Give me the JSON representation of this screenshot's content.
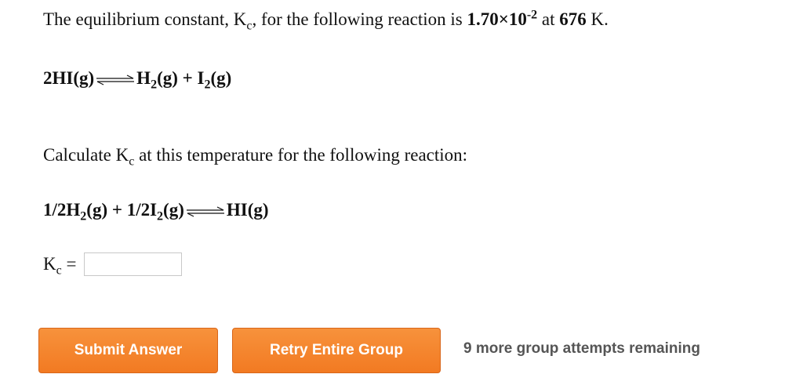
{
  "problem": {
    "intro": {
      "p1": "The equilibrium constant, K",
      "p1_sub": "c",
      "p2": ", for the following reaction is ",
      "value_mantissa": "1.70×10",
      "value_exp": "-2",
      "p3": " at ",
      "temperature": "676",
      "p4": " K."
    },
    "reaction1": {
      "reactant": "2HI(g)",
      "prod1_a": "H",
      "prod1_sub": "2",
      "prod1_b": "(g) + I",
      "prod2_sub": "2",
      "prod2_b": "(g)"
    },
    "question": {
      "p1": "Calculate K",
      "p1_sub": "c",
      "p2": " at this temperature for the following reaction:"
    },
    "reaction2": {
      "r1_a": "1/2H",
      "r1_sub": "2",
      "r1_b": "(g) + 1/2I",
      "r2_sub": "2",
      "r2_b": "(g)",
      "product": "HI(g)"
    },
    "answer": {
      "label": "K",
      "label_sub": "c",
      "equals": " =",
      "value": ""
    }
  },
  "buttons": {
    "submit": "Submit Answer",
    "retry": "Retry Entire Group"
  },
  "status": {
    "attempts": "9 more group attempts remaining"
  },
  "colors": {
    "button": "#f47f28",
    "button_text": "#ffffff",
    "status_text": "#555555"
  }
}
